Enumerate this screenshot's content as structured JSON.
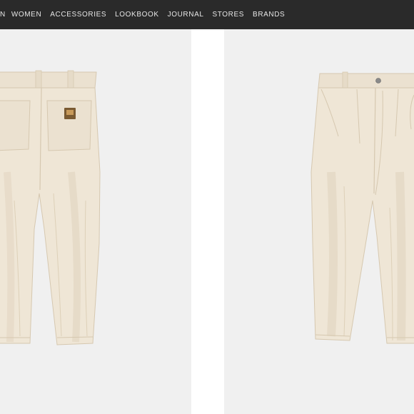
{
  "nav": {
    "items": [
      {
        "label": "N"
      },
      {
        "label": "WOMEN"
      },
      {
        "label": "ACCESSORIES"
      },
      {
        "label": "LOOKBOOK"
      },
      {
        "label": "JOURNAL"
      },
      {
        "label": "STORES"
      },
      {
        "label": "BRANDS"
      }
    ]
  },
  "colors": {
    "nav_bg": "#2a2a2a",
    "nav_text": "#e6e6e6",
    "card_bg": "#f0f0f0",
    "fabric": "#efe6d6",
    "fabric_shadow": "#e2d6c2",
    "seam": "#d6c8b0",
    "label_patch": "#8a6a3a"
  },
  "products": [
    {
      "view": "back",
      "icon": "trousers-back-icon"
    },
    {
      "view": "front",
      "icon": "trousers-front-icon"
    }
  ]
}
